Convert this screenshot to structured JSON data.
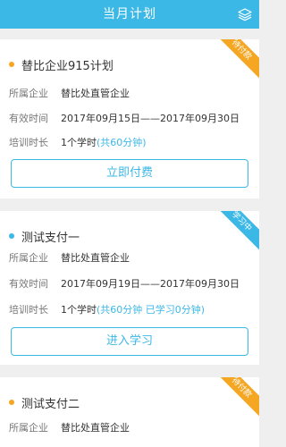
{
  "header": {
    "title": "当月计划"
  },
  "colors": {
    "accent": "#3cb8e6",
    "pending": "#f5a623",
    "studying": "#3cb8e6"
  },
  "plans": [
    {
      "name": "替比企业915计划",
      "ribbon": "待付款",
      "company_label": "所属企业",
      "company": "替比处直管企业",
      "period_label": "有效时间",
      "period": "2017年09月15日——2017年09月30日",
      "hours_label": "培训时长",
      "hours": "1个学时",
      "hours_detail": "(共60分钟)",
      "button": "立即付费"
    },
    {
      "name": "测试支付一",
      "ribbon": "学习中",
      "company_label": "所属企业",
      "company": "替比处直管企业",
      "period_label": "有效时间",
      "period": "2017年09月19日——2017年09月30日",
      "hours_label": "培训时长",
      "hours": "1个学时",
      "hours_detail": "(共60分钟 已学习0分钟)",
      "button": "进入学习"
    },
    {
      "name": "测试支付二",
      "ribbon": "待付款",
      "company_label": "所属企业",
      "company": "替比处直管企业"
    }
  ]
}
